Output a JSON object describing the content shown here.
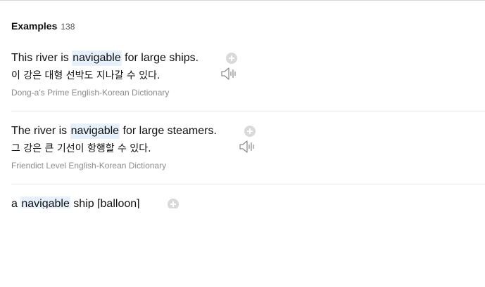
{
  "section": {
    "title": "Examples",
    "count": "138"
  },
  "examples": [
    {
      "before": "This river is ",
      "highlight": "navigable",
      "after": " for large ships.",
      "translation": "이 강은 대형 선박도 지나갈 수 있다.",
      "source": "Dong-a's Prime English-Korean Dictionary"
    },
    {
      "before": "The river is ",
      "highlight": "navigable",
      "after": " for large steamers.",
      "translation": "그 강은 큰 기선이 항행할 수 있다.",
      "source": "Friendict Level English-Korean Dictionary"
    },
    {
      "before": "a ",
      "highlight": "navigable",
      "after": " ship [balloon]",
      "translation": "",
      "source": ""
    }
  ],
  "icons": {
    "speaker": "speaker-icon",
    "add": "add-icon"
  },
  "colors": {
    "highlight_bg": "#e6f1fb",
    "source_text": "#8c8c8c",
    "icon_gray": "#d9d9d9"
  }
}
